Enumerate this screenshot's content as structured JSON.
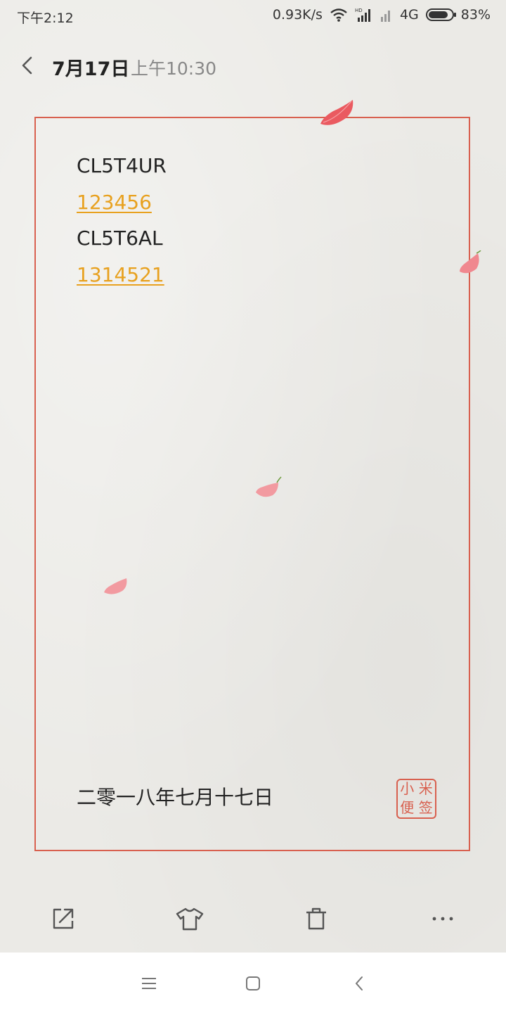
{
  "status_bar": {
    "time": "下午2:12",
    "network_speed": "0.93K/s",
    "signal_icons": [
      "wifi-icon",
      "hd-signal-icon",
      "signal-icon"
    ],
    "network_type": "4G",
    "battery_percent": "83%",
    "battery_level": 0.83
  },
  "header": {
    "date": "7月17日",
    "time": "上午10:30",
    "back_icon": "chevron-left-icon"
  },
  "note": {
    "lines": [
      {
        "text": "CL5T4UR",
        "link": false
      },
      {
        "text": "123456",
        "link": true
      },
      {
        "text": "CL5T6AL",
        "link": false
      },
      {
        "text": "1314521",
        "link": true
      }
    ],
    "footer_date": "二零一八年七月十七日",
    "seal_chars": [
      "小",
      "米",
      "便",
      "签"
    ]
  },
  "colors": {
    "frame": "#d8604f",
    "link": "#e8a11f",
    "petal": "#f08a90"
  },
  "actions": [
    {
      "name": "share-button",
      "icon": "share-icon"
    },
    {
      "name": "theme-button",
      "icon": "shirt-icon"
    },
    {
      "name": "delete-button",
      "icon": "trash-icon"
    },
    {
      "name": "more-button",
      "icon": "more-icon"
    }
  ],
  "nav": [
    {
      "name": "nav-menu-button",
      "icon": "menu-icon"
    },
    {
      "name": "nav-home-button",
      "icon": "square-icon"
    },
    {
      "name": "nav-back-button",
      "icon": "back-icon"
    }
  ]
}
